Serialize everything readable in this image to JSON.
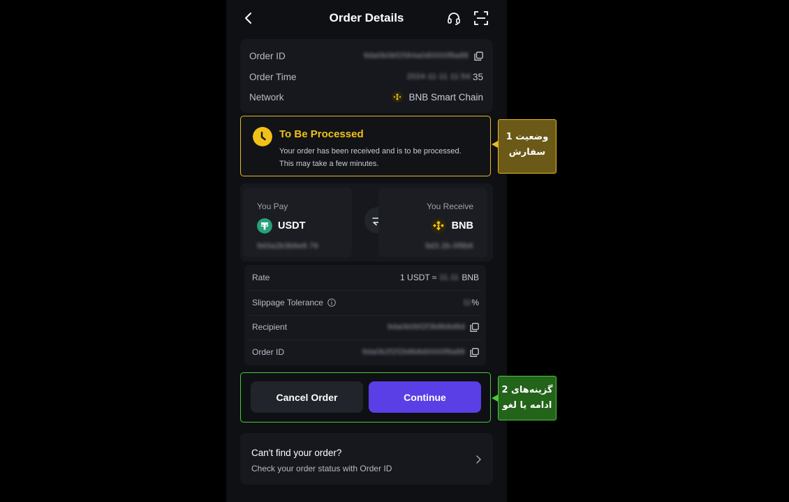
{
  "header": {
    "title": "Order Details"
  },
  "order_info": {
    "order_id_label": "Order ID",
    "order_id_value": "9da0b0bf2584a0d0000f8a88",
    "order_time_label": "Order Time",
    "order_time_value": "2024-11-11 11:54:",
    "order_time_suffix": "35",
    "network_label": "Network",
    "network_value": "BNB Smart Chain"
  },
  "status": {
    "title": "To Be Processed",
    "line1": "Your order has been received and is to be processed.",
    "line2": "This may take a few minutes.",
    "color": "#f2c118"
  },
  "swap": {
    "pay_label": "You Pay",
    "pay_coin": "USDT",
    "pay_amount": "9d3a2b3b6e8.76",
    "receive_label": "You Receive",
    "receive_coin": "BNB",
    "receive_amount": "9d3.2b.0f8b6"
  },
  "details": {
    "rate_label": "Rate",
    "rate_prefix": "1 USDT ≈",
    "rate_value": "11.11",
    "rate_suffix": "BNB",
    "slippage_label": "Slippage Tolerance",
    "slippage_value": "11",
    "slippage_suffix": "%",
    "recipient_label": "Recipient",
    "recipient_value": "9da0b0bf2f3b8b8d8d",
    "order_id_label": "Order ID",
    "order_id_value": "9da0b2f2f2b8b8d0000f8a88"
  },
  "actions": {
    "cancel_label": "Cancel Order",
    "continue_label": "Continue",
    "accent": "#5a3fe6"
  },
  "help": {
    "title": "Can't find your order?",
    "subtitle": "Check your order status with Order ID"
  },
  "callouts": {
    "status_line1": "وضعیت 1",
    "status_line2": "سفارش",
    "options_line1": "گزینه‌های 2",
    "options_line2": "ادامه یا لغو"
  }
}
